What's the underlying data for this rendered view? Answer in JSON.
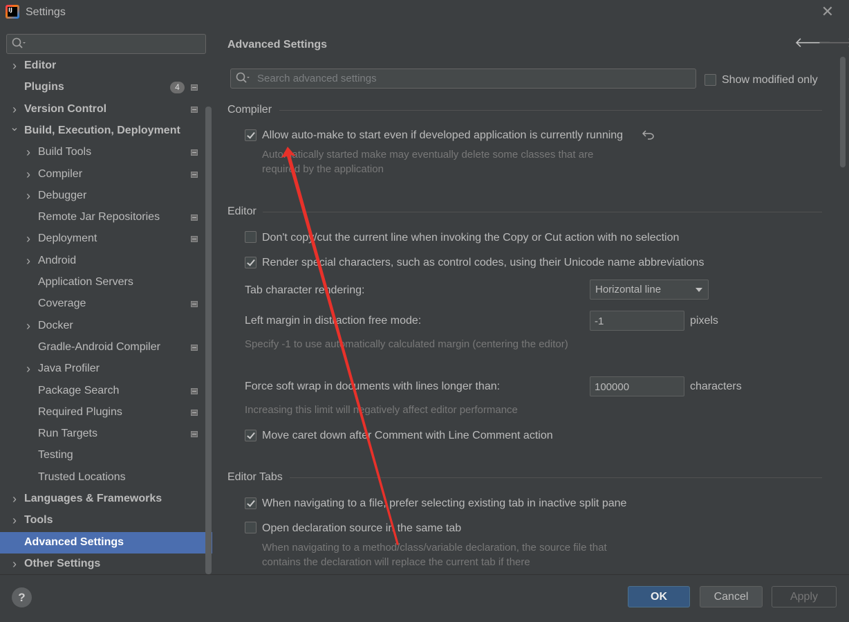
{
  "window": {
    "title": "Settings",
    "app_icon": "intellij-idea-icon",
    "close_icon": "close-icon"
  },
  "sidebar": {
    "search": {
      "value": "",
      "placeholder": ""
    },
    "items": [
      {
        "label": "Editor",
        "bold": true,
        "expandable": true,
        "expanded": false,
        "indent": 0,
        "project_icon": false
      },
      {
        "label": "Plugins",
        "bold": true,
        "expandable": false,
        "indent": 0,
        "badge": "4",
        "project_icon": true
      },
      {
        "label": "Version Control",
        "bold": true,
        "expandable": true,
        "expanded": false,
        "indent": 0,
        "project_icon": true
      },
      {
        "label": "Build, Execution, Deployment",
        "bold": true,
        "expandable": true,
        "expanded": true,
        "indent": 0,
        "project_icon": false
      },
      {
        "label": "Build Tools",
        "bold": false,
        "expandable": true,
        "indent": 1,
        "project_icon": true
      },
      {
        "label": "Compiler",
        "bold": false,
        "expandable": true,
        "indent": 1,
        "project_icon": true
      },
      {
        "label": "Debugger",
        "bold": false,
        "expandable": true,
        "indent": 1,
        "project_icon": false
      },
      {
        "label": "Remote Jar Repositories",
        "bold": false,
        "expandable": false,
        "indent": 1,
        "project_icon": true
      },
      {
        "label": "Deployment",
        "bold": false,
        "expandable": true,
        "indent": 1,
        "project_icon": true
      },
      {
        "label": "Android",
        "bold": false,
        "expandable": true,
        "indent": 1,
        "project_icon": false
      },
      {
        "label": "Application Servers",
        "bold": false,
        "expandable": false,
        "indent": 1,
        "project_icon": false
      },
      {
        "label": "Coverage",
        "bold": false,
        "expandable": false,
        "indent": 1,
        "project_icon": true
      },
      {
        "label": "Docker",
        "bold": false,
        "expandable": true,
        "indent": 1,
        "project_icon": false
      },
      {
        "label": "Gradle-Android Compiler",
        "bold": false,
        "expandable": false,
        "indent": 1,
        "project_icon": true
      },
      {
        "label": "Java Profiler",
        "bold": false,
        "expandable": true,
        "indent": 1,
        "project_icon": false
      },
      {
        "label": "Package Search",
        "bold": false,
        "expandable": false,
        "indent": 1,
        "project_icon": true
      },
      {
        "label": "Required Plugins",
        "bold": false,
        "expandable": false,
        "indent": 1,
        "project_icon": true
      },
      {
        "label": "Run Targets",
        "bold": false,
        "expandable": false,
        "indent": 1,
        "project_icon": true
      },
      {
        "label": "Testing",
        "bold": false,
        "expandable": false,
        "indent": 1,
        "project_icon": false
      },
      {
        "label": "Trusted Locations",
        "bold": false,
        "expandable": false,
        "indent": 1,
        "project_icon": false
      },
      {
        "label": "Languages & Frameworks",
        "bold": true,
        "expandable": true,
        "expanded": false,
        "indent": 0,
        "project_icon": false
      },
      {
        "label": "Tools",
        "bold": true,
        "expandable": true,
        "expanded": false,
        "indent": 0,
        "project_icon": false
      },
      {
        "label": "Advanced Settings",
        "bold": true,
        "expandable": false,
        "indent": 0,
        "selected": true,
        "project_icon": false
      },
      {
        "label": "Other Settings",
        "bold": true,
        "expandable": true,
        "expanded": false,
        "indent": 0,
        "project_icon": false
      }
    ]
  },
  "main": {
    "title": "Advanced Settings",
    "nav_back_icon": "arrow-left-icon",
    "nav_forward_icon": "arrow-right-icon",
    "search": {
      "value": "",
      "placeholder": "Search advanced settings"
    },
    "show_modified_only": {
      "label": "Show modified only",
      "checked": false
    },
    "sections": {
      "compiler": {
        "title": "Compiler",
        "auto_make": {
          "label": "Allow auto-make to start even if developed application is currently running",
          "checked": true,
          "hint": "Automatically started make may eventually delete some classes that are required by the application"
        }
      },
      "editor": {
        "title": "Editor",
        "copy_cut": {
          "label": "Don't copy/cut the current line when invoking the Copy or Cut action with no selection",
          "checked": false
        },
        "render_special": {
          "label": "Render special characters, such as control codes, using their Unicode name abbreviations",
          "checked": true
        },
        "tab_rendering": {
          "label": "Tab character rendering:",
          "value": "Horizontal line"
        },
        "left_margin": {
          "label": "Left margin in distraction free mode:",
          "value": "-1",
          "unit": "pixels",
          "hint": "Specify -1 to use automatically calculated margin (centering the editor)"
        },
        "soft_wrap": {
          "label": "Force soft wrap in documents with lines longer than:",
          "value": "100000",
          "unit": "characters",
          "hint": "Increasing this limit will negatively affect editor performance"
        },
        "move_caret": {
          "label": "Move caret down after Comment with Line Comment action",
          "checked": true
        }
      },
      "editor_tabs": {
        "title": "Editor Tabs",
        "prefer_existing": {
          "label": "When navigating to a file, prefer selecting existing tab in inactive split pane",
          "checked": true
        },
        "open_same_tab": {
          "label": "Open declaration source in the same tab",
          "checked": false,
          "hint": "When navigating to a method/class/variable declaration, the source file that contains the declaration will replace the current tab if there"
        }
      }
    }
  },
  "footer": {
    "help_label": "?",
    "ok_label": "OK",
    "cancel_label": "Cancel",
    "apply_label": "Apply"
  },
  "colors": {
    "background": "#3c3f41",
    "selection": "#4b6eaf",
    "ok_button": "#365880",
    "annotation_arrow": "#e8312a"
  }
}
